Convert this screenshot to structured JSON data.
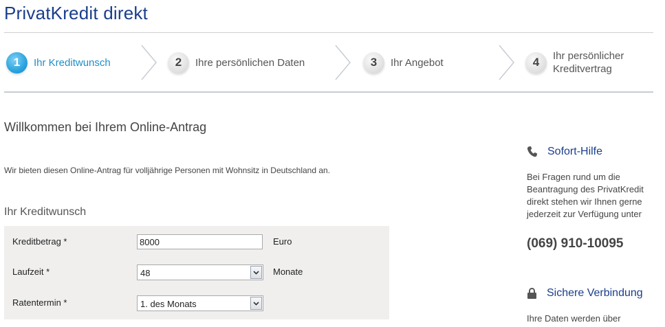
{
  "app": {
    "title": "PrivatKredit direkt"
  },
  "steps": [
    {
      "number": "1",
      "label": "Ihr Kreditwunsch",
      "active": true
    },
    {
      "number": "2",
      "label": "Ihre persönlichen Daten",
      "active": false
    },
    {
      "number": "3",
      "label": "Ihr Angebot",
      "active": false
    },
    {
      "number": "4",
      "label_line1": "Ihr persönlicher",
      "label_line2": "Kreditvertrag",
      "active": false
    }
  ],
  "main": {
    "heading": "Willkommen bei Ihrem Online-Antrag",
    "intro": "Wir bieten diesen Online-Antrag für volljährige Personen mit Wohnsitz in Deutschland an.",
    "section_title": "Ihr Kreditwunsch"
  },
  "form": {
    "kreditbetrag": {
      "label": "Kreditbetrag  *",
      "value": "8000",
      "unit": "Euro"
    },
    "laufzeit": {
      "label": "Laufzeit  *",
      "value": "48",
      "unit": "Monate"
    },
    "ratentermin": {
      "label": "Ratentermin  *",
      "value": "1. des Monats"
    }
  },
  "aside": {
    "help": {
      "title": "Sofort-Hilfe",
      "text": "Bei Fragen rund um die Beantragung des PrivatKredit direkt stehen wir Ihnen gerne jederzeit zur Verfügung unter",
      "phone": "(069) 910-10095",
      "icon": "phone-icon"
    },
    "secure": {
      "title": "Sichere Verbindung",
      "text": "Ihre Daten werden über",
      "icon": "lock-icon"
    }
  },
  "colors": {
    "brand": "#1a3e8c",
    "active_step": "#2aa3de",
    "panel": "#f0efee"
  }
}
